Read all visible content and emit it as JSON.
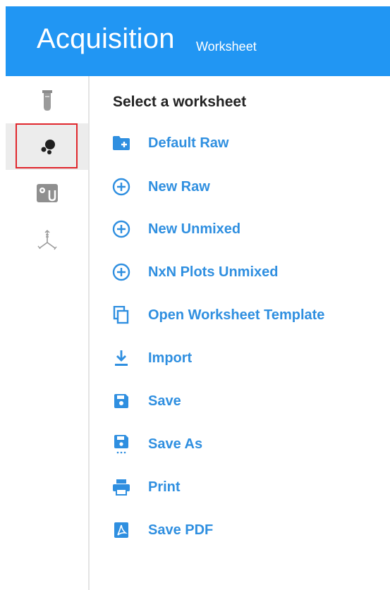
{
  "header": {
    "title": "Acquisition",
    "subtitle": "Worksheet"
  },
  "sidebar": {
    "items": [
      {
        "name": "tube-icon",
        "active": false
      },
      {
        "name": "dots-plot-icon",
        "active": true
      },
      {
        "name": "settings-tube-icon",
        "active": false
      },
      {
        "name": "axes-icon",
        "active": false
      }
    ]
  },
  "main": {
    "title": "Select a worksheet",
    "items": [
      {
        "label": "Default Raw",
        "icon": "folder-plus-icon"
      },
      {
        "label": "New Raw",
        "icon": "plus-circle-icon"
      },
      {
        "label": "New Unmixed",
        "icon": "plus-circle-icon"
      },
      {
        "label": "NxN Plots Unmixed",
        "icon": "plus-circle-icon"
      },
      {
        "label": "Open Worksheet Template",
        "icon": "copy-icon"
      },
      {
        "label": "Import",
        "icon": "download-icon"
      },
      {
        "label": "Save",
        "icon": "save-icon"
      },
      {
        "label": "Save As",
        "icon": "save-as-icon"
      },
      {
        "label": "Print",
        "icon": "print-icon"
      },
      {
        "label": "Save PDF",
        "icon": "pdf-icon"
      }
    ]
  },
  "colors": {
    "header": "#2196f3",
    "accent": "#2f8fe0",
    "highlight": "#e0262c"
  }
}
